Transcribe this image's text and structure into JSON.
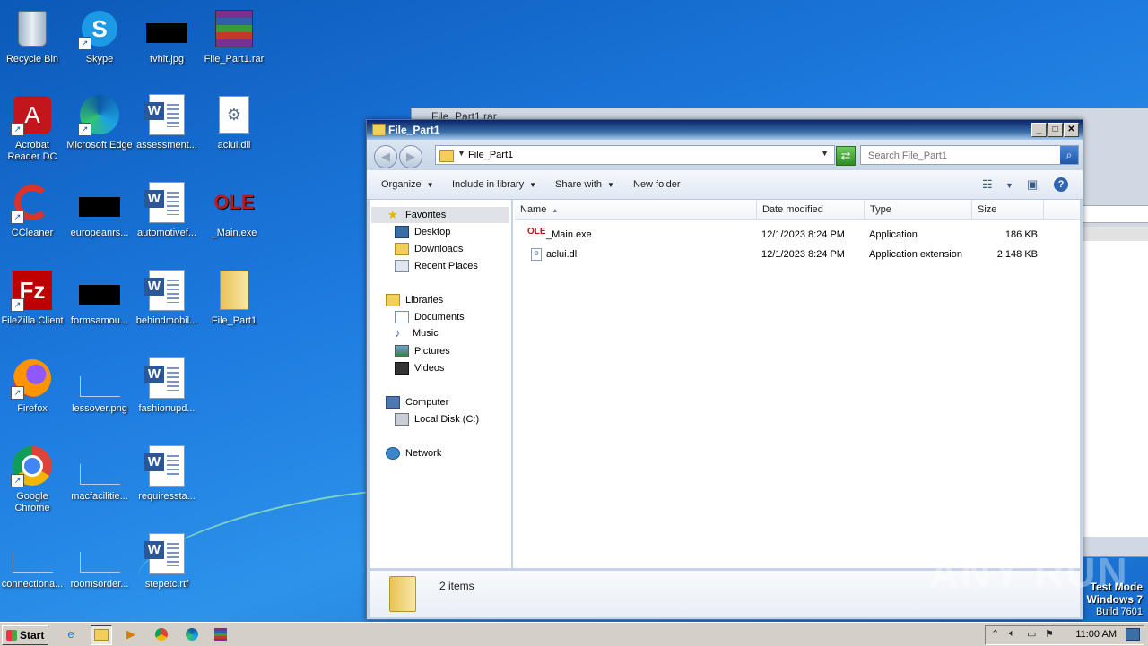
{
  "desktop": {
    "icons": [
      {
        "label": "Recycle Bin"
      },
      {
        "label": "Skype"
      },
      {
        "label": "tvhit.jpg"
      },
      {
        "label": "File_Part1.rar"
      },
      {
        "label": "Acrobat Reader DC"
      },
      {
        "label": "Microsoft Edge"
      },
      {
        "label": "assessment..."
      },
      {
        "label": "aclui.dll"
      },
      {
        "label": "CCleaner"
      },
      {
        "label": "europeanrs..."
      },
      {
        "label": "automotivef..."
      },
      {
        "label": "_Main.exe"
      },
      {
        "label": "FileZilla Client"
      },
      {
        "label": "formsamou..."
      },
      {
        "label": "behindmobil..."
      },
      {
        "label": "File_Part1"
      },
      {
        "label": "Firefox"
      },
      {
        "label": "lessover.png"
      },
      {
        "label": "fashionupd..."
      },
      {
        "label": "Google Chrome"
      },
      {
        "label": "macfacilitie..."
      },
      {
        "label": "requiressta..."
      },
      {
        "label": "connectiona..."
      },
      {
        "label": "roomsorder..."
      },
      {
        "label": "stepetc.rtf"
      }
    ]
  },
  "bg_window": {
    "title": "File_Part1.rar"
  },
  "explorer": {
    "title": "File_Part1",
    "address": {
      "path": "File_Part1"
    },
    "search": {
      "placeholder": "Search File_Part1"
    },
    "toolbar": {
      "organize": "Organize",
      "include_in_library": "Include in library",
      "share_with": "Share with",
      "new_folder": "New folder"
    },
    "nav": {
      "favorites": "Favorites",
      "desktop": "Desktop",
      "downloads": "Downloads",
      "recent_places": "Recent Places",
      "libraries": "Libraries",
      "documents": "Documents",
      "music": "Music",
      "pictures": "Pictures",
      "videos": "Videos",
      "computer": "Computer",
      "local_disk": "Local Disk (C:)",
      "network": "Network"
    },
    "columns": {
      "name": "Name",
      "date": "Date modified",
      "type": "Type",
      "size": "Size"
    },
    "files": [
      {
        "name": "_Main.exe",
        "date": "12/1/2023 8:24 PM",
        "type": "Application",
        "size": "186 KB"
      },
      {
        "name": "aclui.dll",
        "date": "12/1/2023 8:24 PM",
        "type": "Application extension",
        "size": "2,148 KB"
      }
    ],
    "details": {
      "count": "2 items"
    }
  },
  "watermark": {
    "text": "ANY RUN"
  },
  "testmode": {
    "line1": "Test Mode",
    "line2": "Windows 7",
    "line3": "Build 7601"
  },
  "taskbar": {
    "start": "Start",
    "clock": "11:00 AM"
  }
}
